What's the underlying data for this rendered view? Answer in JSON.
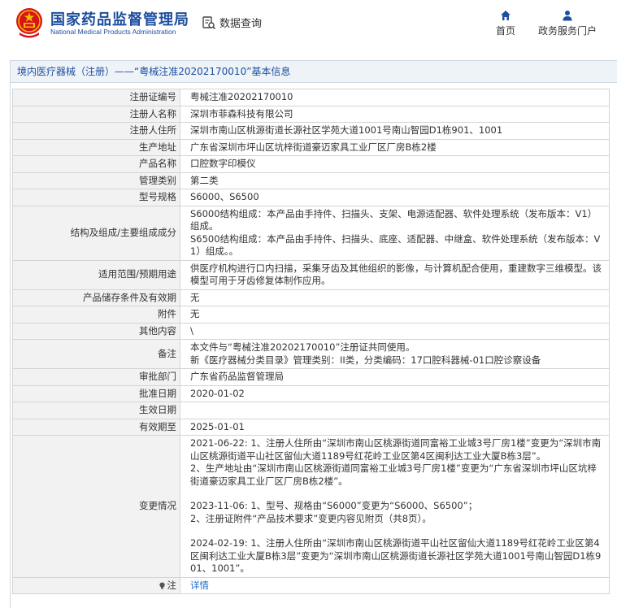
{
  "header": {
    "brand_cn": "国家药品监督管理局",
    "brand_en": "National Medical Products Administration",
    "query_label": "数据查询",
    "nav_home": "首页",
    "nav_portal": "政务服务门户",
    "colors": {
      "brand": "#1d4e9e",
      "emblem_red": "#d7141b",
      "emblem_gold": "#f2c200"
    }
  },
  "panel": {
    "title": "境内医疗器械（注册）——“粤械注准20202170010”基本信息"
  },
  "rows": [
    {
      "label": "注册证编号",
      "value": [
        "粤械注准20202170010"
      ]
    },
    {
      "label": "注册人名称",
      "value": [
        "深圳市菲森科技有限公司"
      ]
    },
    {
      "label": "注册人住所",
      "value": [
        "深圳市南山区桃源街道长源社区学苑大道1001号南山智园D1栋901、1001"
      ]
    },
    {
      "label": "生产地址",
      "value": [
        "广东省深圳市坪山区坑梓街道豪迈家具工业厂区厂房B栋2楼"
      ]
    },
    {
      "label": "产品名称",
      "value": [
        "口腔数字印模仪"
      ]
    },
    {
      "label": "管理类别",
      "value": [
        "第二类"
      ]
    },
    {
      "label": "型号规格",
      "value": [
        "S6000、S6500"
      ]
    },
    {
      "label": "结构及组成/主要组成成分",
      "value": [
        "S6000结构组成：本产品由手持件、扫描头、支架、电源适配器、软件处理系统（发布版本：V1）组成。",
        "S6500结构组成：本产品由手持件、扫描头、底座、适配器、中继盒、软件处理系统（发布版本：V1）组成。。"
      ]
    },
    {
      "label": "适用范围/预期用途",
      "value": [
        "供医疗机构进行口内扫描，采集牙齿及其他组织的影像，与计算机配合使用，重建数字三维模型。该模型可用于牙齿修复体制作应用。"
      ]
    },
    {
      "label": "产品储存条件及有效期",
      "value": [
        "无"
      ]
    },
    {
      "label": "附件",
      "value": [
        "无"
      ]
    },
    {
      "label": "其他内容",
      "value": [
        "\\"
      ]
    },
    {
      "label": "备注",
      "value": [
        "本文件与“粤械注准20202170010”注册证共同使用。",
        "新《医疗器械分类目录》管理类别：II类，分类编码：17口腔科器械-01口腔诊察设备"
      ]
    },
    {
      "label": "审批部门",
      "value": [
        "广东省药品监督管理局"
      ]
    },
    {
      "label": "批准日期",
      "value": [
        "2020-01-02"
      ]
    },
    {
      "label": "生效日期",
      "value": [
        ""
      ]
    },
    {
      "label": "有效期至",
      "value": [
        "2025-01-01"
      ]
    },
    {
      "label": "变更情况",
      "value": [
        "2021-06-22: 1、注册人住所由“深圳市南山区桃源街道同富裕工业城3号厂房1楼”变更为“深圳市南山区桃源街道平山社区留仙大道1189号红花岭工业区第4区闽利达工业大厦B栋3层”。",
        "2、生产地址由“深圳市南山区桃源街道同富裕工业城3号厂房1楼”变更为“广东省深圳市坪山区坑梓街道豪迈家具工业厂区厂房B栋2楼”。",
        "",
        "2023-11-06: 1、型号、规格由“S6000”变更为“S6000、S6500”；",
        "2、注册证附件“产品技术要求”变更内容见附页（共8页）。",
        "",
        "2024-02-19: 1、注册人住所由“深圳市南山区桃源街道平山社区留仙大道1189号红花岭工业区第4区闽利达工业大厦B栋3层”变更为“深圳市南山区桃源街道长源社区学苑大道1001号南山智园D1栋901、1001”。"
      ]
    }
  ],
  "footer_row": {
    "label": "注",
    "link": "详情"
  }
}
